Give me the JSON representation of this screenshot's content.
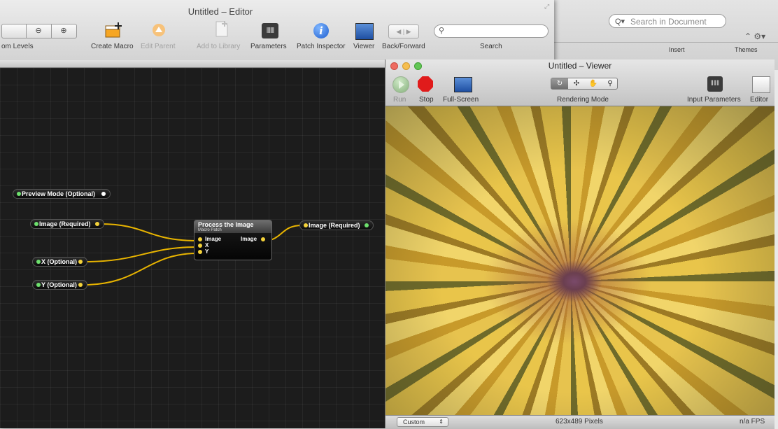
{
  "background_app": {
    "search_placeholder": "Search in Document",
    "tabs": [
      "Insert",
      "Themes"
    ]
  },
  "editor": {
    "title": "Untitled – Editor",
    "zoom_label": "om Levels",
    "toolbar": {
      "create_macro": "Create Macro",
      "edit_parent": "Edit Parent",
      "add_to_library": "Add to Library",
      "parameters": "Parameters",
      "patch_inspector": "Patch Inspector",
      "viewer": "Viewer",
      "back_forward": "Back/Forward",
      "search": "Search"
    },
    "nodes": {
      "preview_mode": "Preview Mode (Optional)",
      "image_required_in": "Image (Required)",
      "x_optional": "X (Optional)",
      "y_optional": "Y (Optional)",
      "image_required_out": "Image (Required)"
    },
    "macro": {
      "title": "Process the Image",
      "subtitle": "Macro Patch",
      "inputs": [
        "Image",
        "X",
        "Y"
      ],
      "output": "Image"
    }
  },
  "viewer": {
    "title": "Untitled – Viewer",
    "run": "Run",
    "stop": "Stop",
    "full_screen": "Full-Screen",
    "rendering_mode": "Rendering Mode",
    "input_parameters": "Input Parameters",
    "editor": "Editor",
    "status": {
      "mode": "Custom",
      "size": "623x489 Pixels",
      "fps": "n/a FPS"
    }
  },
  "colors": {
    "wire": "#e8b400",
    "port_green": "#6de06d",
    "port_yellow": "#f4d23a"
  }
}
